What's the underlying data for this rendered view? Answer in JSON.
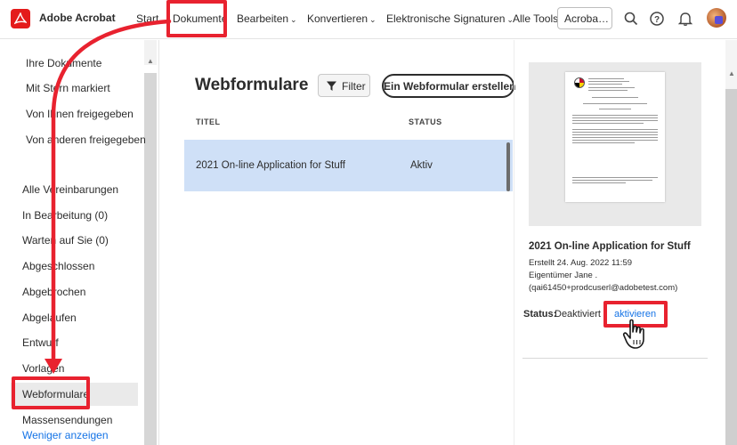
{
  "header": {
    "app_name": "Adobe Acrobat",
    "nav": [
      {
        "label": "Start",
        "has_menu": false
      },
      {
        "label": "Dokumente",
        "has_menu": false
      },
      {
        "label": "Bearbeiten",
        "has_menu": true
      },
      {
        "label": "Konvertieren",
        "has_menu": true
      },
      {
        "label": "Elektronische Signaturen",
        "has_menu": true
      },
      {
        "label": "Alle Tools",
        "has_menu": false
      }
    ],
    "acrobat_button": "Acroba…",
    "icons": [
      "search-icon",
      "help-icon",
      "bell-icon",
      "avatar"
    ],
    "brand_color": "#e41b1b"
  },
  "sidebar": {
    "top_items": [
      "Ihre Dokumente",
      "Mit Stern markiert",
      "Von Ihnen freigegeben",
      "Von anderen freigegeben"
    ],
    "agreement_items": [
      "Alle Vereinbarungen",
      "In Bearbeitung (0)",
      "Warten auf Sie (0)",
      "Abgeschlossen",
      "Abgebrochen",
      "Abgelaufen",
      "Entwurf",
      "Vorlagen",
      "Webformulare",
      "Massensendungen"
    ],
    "active_item": "Webformulare",
    "show_less_link": "Weniger anzeigen"
  },
  "main": {
    "title": "Webformulare",
    "filter_label": "Filter",
    "create_label": "Ein Webformular erstellen",
    "columns": [
      "TITEL",
      "STATUS"
    ],
    "rows": [
      {
        "title": "2021 On-line Application for Stuff",
        "status": "Aktiv"
      }
    ]
  },
  "details": {
    "title": "2021 On-line Application for Stuff",
    "created": "Erstellt 24. Aug. 2022 11:59",
    "owner": "Eigentümer Jane .",
    "owner_email": "(qai61450+prodcuserl@adobetest.com)",
    "status_label": "Status:",
    "status_value": "Deaktiviert",
    "activate_link": "aktivieren"
  },
  "annotation_color": "#e8222f",
  "link_color": "#1473e6",
  "selected_row_color": "#cfe0f7"
}
